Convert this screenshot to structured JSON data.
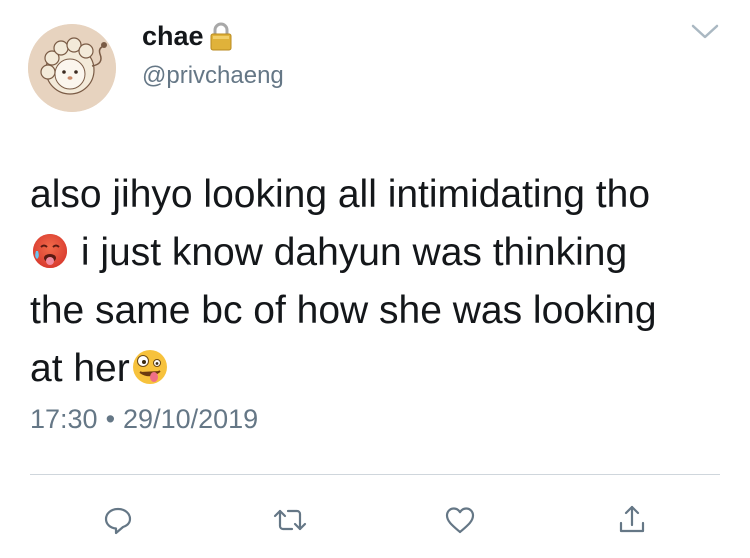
{
  "tweet": {
    "author": {
      "display_name": "chae",
      "handle": "@privchaeng",
      "locked_icon": "lock-icon",
      "avatar_icon": "lion-avatar"
    },
    "text_lines": [
      "also jihyo looking all intimidating tho",
      " i just know dahyun was thinking",
      "the same bc of how she was looking",
      "at her"
    ],
    "emojis": [
      "hot-face-emoji",
      "zany-face-emoji"
    ],
    "time": "17:30",
    "separator": "•",
    "date": "29/10/2019"
  },
  "actions": [
    {
      "icon": "reply-icon"
    },
    {
      "icon": "retweet-icon"
    },
    {
      "icon": "like-icon"
    },
    {
      "icon": "share-icon"
    }
  ],
  "colors": {
    "text": "#14171a",
    "secondary": "#657786",
    "divider": "#cfd6dc",
    "icon": "#657786"
  }
}
